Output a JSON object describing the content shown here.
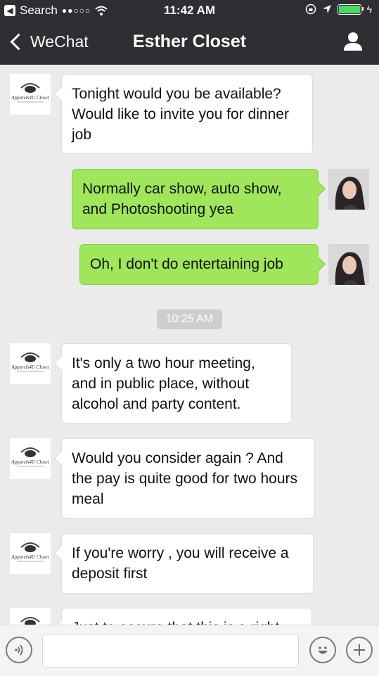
{
  "status_bar": {
    "carrier": "Search",
    "signal": "●●○○○",
    "time": "11:42 AM"
  },
  "nav": {
    "back_label": "WeChat",
    "title": "Esther Closet"
  },
  "messages": [
    {
      "side": "in",
      "text": "Tonight would you be available? Would like to invite you for dinner job"
    },
    {
      "side": "out",
      "text": "Normally car show, auto show, and Photoshooting yea"
    },
    {
      "side": "out",
      "text": "Oh, I don't do entertaining job"
    },
    {
      "side": "in",
      "text": "It's only a two hour meeting, and in public place, without alcohol and party content."
    },
    {
      "side": "in",
      "text": "Would you consider again ? And the pay is quite good for two hours meal"
    },
    {
      "side": "in",
      "text": "If you're worry , you will receive a deposit first"
    },
    {
      "side": "in",
      "text": "Just to assure that this is a right"
    }
  ],
  "timestamp": "10:25 AM",
  "contact_logo_text": "Apparels4U Closet",
  "colors": {
    "nav_bg": "#2e2e33",
    "chat_bg": "#ebebeb",
    "outgoing_bubble": "#9fe65a",
    "incoming_bubble": "#ffffff"
  },
  "icons": {
    "voice": "voice-icon",
    "emoji": "emoji-icon",
    "plus": "plus-icon",
    "contact": "person-icon"
  }
}
